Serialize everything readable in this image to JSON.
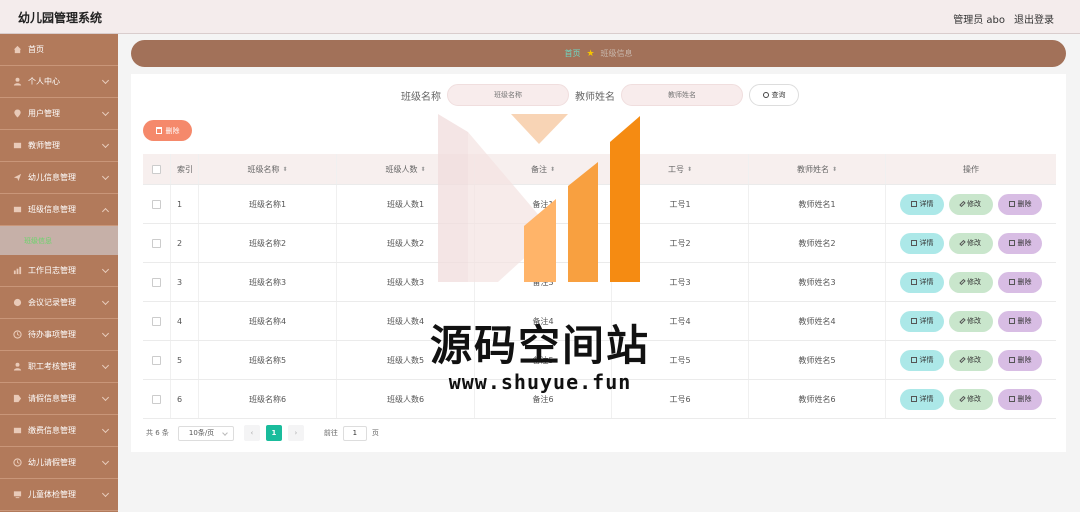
{
  "header": {
    "app_title": "幼儿园管理系统",
    "user": "管理员 abo",
    "logout": "退出登录"
  },
  "sidebar": {
    "items": [
      {
        "label": "首页",
        "icon": "home-icon"
      },
      {
        "label": "个人中心",
        "icon": "person-icon"
      },
      {
        "label": "用户管理",
        "icon": "location-icon"
      },
      {
        "label": "教师管理",
        "icon": "grid-icon"
      },
      {
        "label": "幼儿信息管理",
        "icon": "send-icon"
      },
      {
        "label": "班级信息管理",
        "icon": "grid-icon"
      }
    ],
    "active_sub": "班级信息",
    "items_after": [
      {
        "label": "工作日志管理",
        "icon": "chart-icon"
      },
      {
        "label": "会议记录管理",
        "icon": "shield-icon"
      },
      {
        "label": "待办事项管理",
        "icon": "clock-icon"
      },
      {
        "label": "职工考核管理",
        "icon": "person-icon"
      },
      {
        "label": "请假信息管理",
        "icon": "tag-icon"
      },
      {
        "label": "缴费信息管理",
        "icon": "grid-icon"
      },
      {
        "label": "幼儿请假管理",
        "icon": "clock-icon"
      },
      {
        "label": "儿童体检管理",
        "icon": "monitor-icon"
      }
    ]
  },
  "breadcrumb": {
    "home": "首页",
    "current": "班级信息"
  },
  "search": {
    "class_label": "班级名称",
    "class_placeholder": "班级名称",
    "teacher_label": "教师姓名",
    "teacher_placeholder": "教师姓名",
    "button": "查询"
  },
  "toolbar": {
    "delete": "删除"
  },
  "table": {
    "headers": {
      "index": "索引",
      "class_name": "班级名称",
      "class_count": "班级人数",
      "note": "备注",
      "job_no": "工号",
      "teacher_name": "教师姓名",
      "ops": "操作"
    },
    "rows": [
      {
        "index": "1",
        "class_name": "班级名称1",
        "class_count": "班级人数1",
        "note": "备注1",
        "job_no": "工号1",
        "teacher_name": "教师姓名1"
      },
      {
        "index": "2",
        "class_name": "班级名称2",
        "class_count": "班级人数2",
        "note": "备注2",
        "job_no": "工号2",
        "teacher_name": "教师姓名2"
      },
      {
        "index": "3",
        "class_name": "班级名称3",
        "class_count": "班级人数3",
        "note": "备注3",
        "job_no": "工号3",
        "teacher_name": "教师姓名3"
      },
      {
        "index": "4",
        "class_name": "班级名称4",
        "class_count": "班级人数4",
        "note": "备注4",
        "job_no": "工号4",
        "teacher_name": "教师姓名4"
      },
      {
        "index": "5",
        "class_name": "班级名称5",
        "class_count": "班级人数5",
        "note": "备注5",
        "job_no": "工号5",
        "teacher_name": "教师姓名5"
      },
      {
        "index": "6",
        "class_name": "班级名称6",
        "class_count": "班级人数6",
        "note": "备注6",
        "job_no": "工号6",
        "teacher_name": "教师姓名6"
      }
    ],
    "op_labels": {
      "detail": "详情",
      "edit": "修改",
      "delete": "删除"
    }
  },
  "pagination": {
    "total": "共 6 条",
    "page_size": "10条/页",
    "prev": "‹",
    "current_page": "1",
    "next": "›",
    "goto_label": "前往",
    "goto_value": "1",
    "page_suffix": "页"
  },
  "watermark": {
    "title": "源码空间站",
    "url": "www.shuyue.fun"
  },
  "colors": {
    "sidebar": "#b27a5b",
    "breadcrumb": "#a27159",
    "accent_teal": "#1abc9c",
    "delete_button": "#f5896b"
  }
}
